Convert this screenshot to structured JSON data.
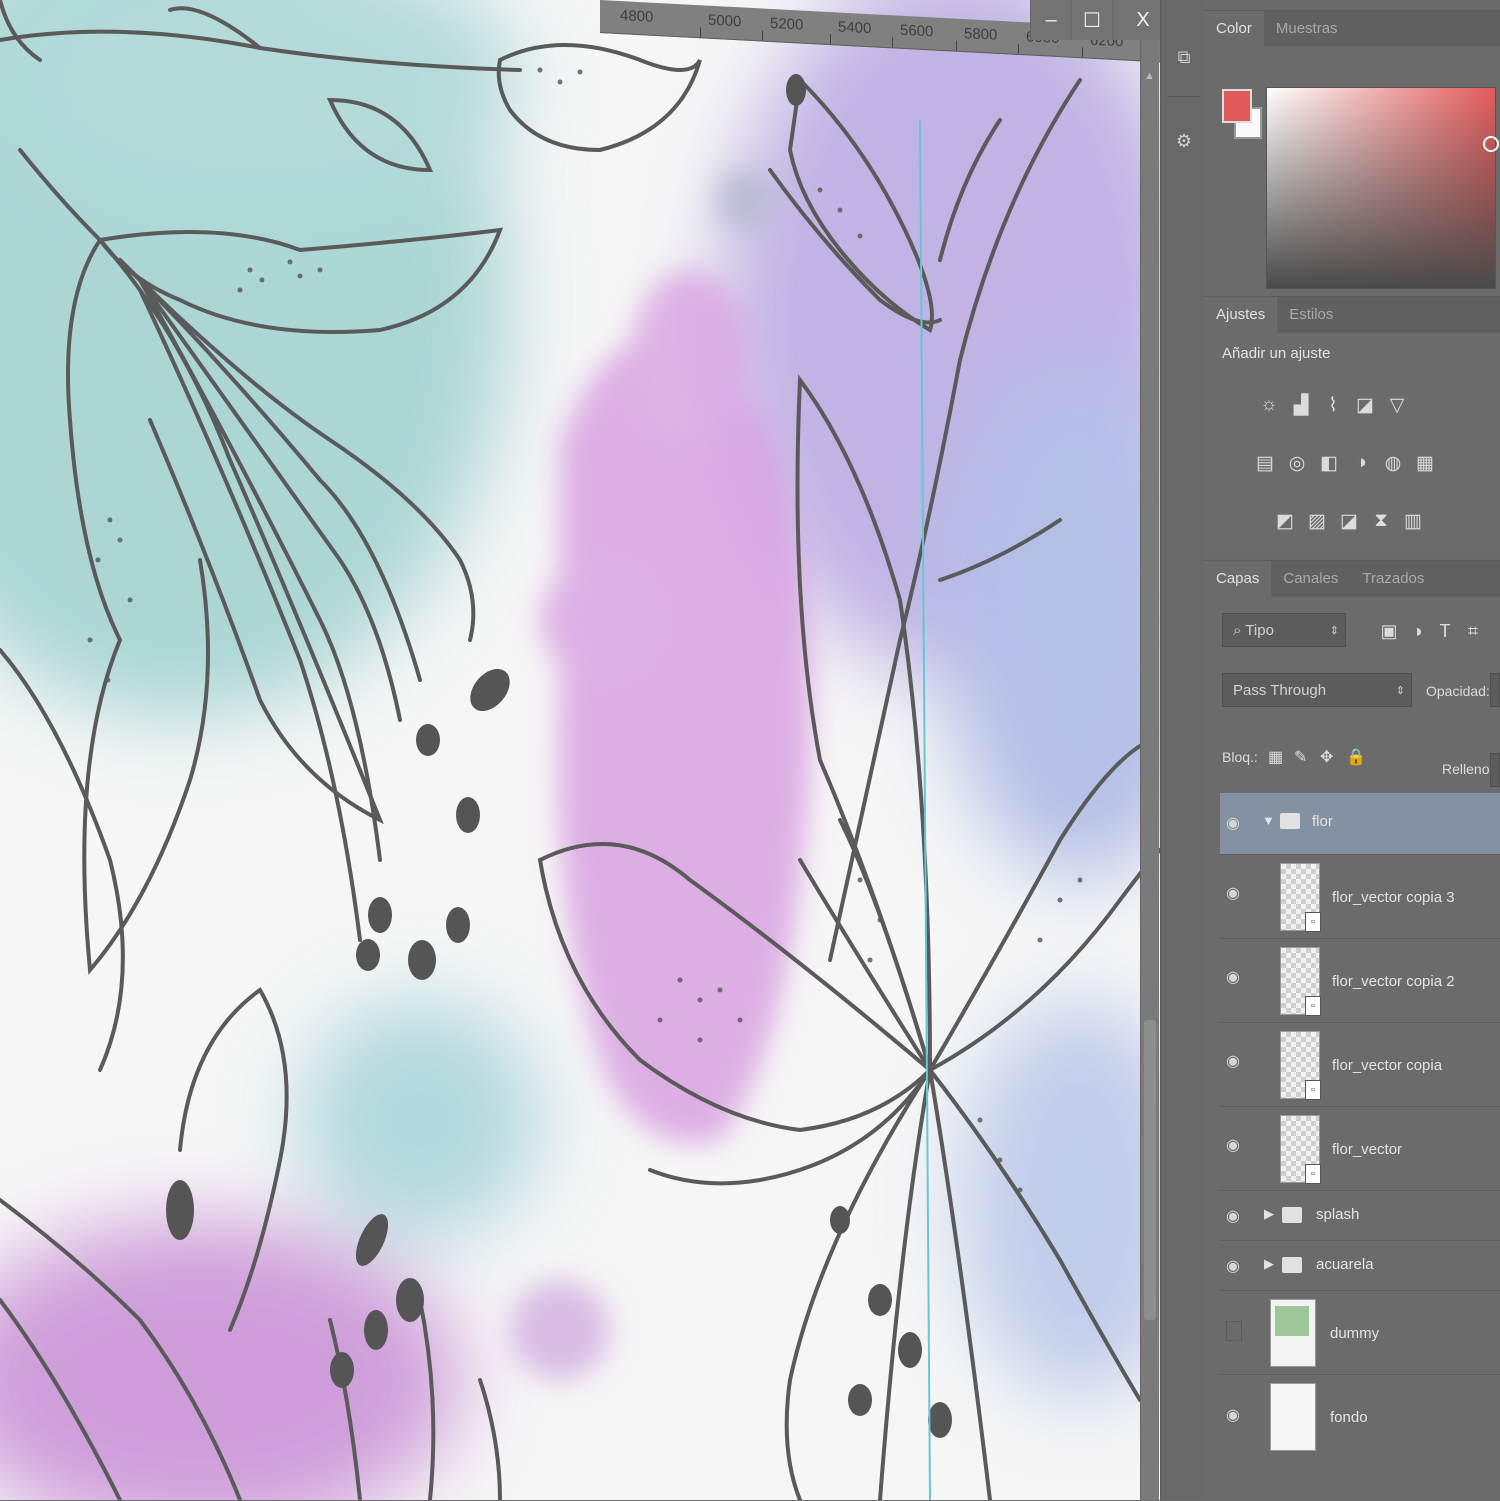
{
  "ruler": {
    "ticks": [
      "4800",
      "5000",
      "5200",
      "5400",
      "5600",
      "5800",
      "6000",
      "6200"
    ]
  },
  "window": {
    "minimize": "–",
    "maximize": "☐",
    "close": "X"
  },
  "color_panel": {
    "tabs": [
      "Color",
      "Muestras"
    ],
    "foreground": "#e05a5a",
    "background": "#fafafa"
  },
  "adjustments_panel": {
    "tabs": [
      "Ajustes",
      "Estilos"
    ],
    "title": "Añadir un ajuste",
    "rows": [
      [
        "brightness-icon",
        "levels-icon",
        "curves-icon",
        "exposure-icon",
        "gradient-triangle-icon"
      ],
      [
        "vibrance-icon",
        "hue-saturation-icon",
        "color-balance-icon",
        "black-white-icon",
        "photo-filter-icon",
        "channel-mixer-icon",
        "color-lookup-icon"
      ],
      [
        "invert-icon",
        "posterize-icon",
        "threshold-icon",
        "selective-color-icon",
        "gradient-map-icon"
      ]
    ],
    "row_glyphs": [
      [
        "☼",
        "▟",
        "⌇",
        "◪",
        "▽"
      ],
      [
        "▤",
        "◎",
        "◧",
        "◑",
        "◍",
        "▦"
      ],
      [
        "◩",
        "▨",
        "◪",
        "⧗",
        "▥"
      ]
    ]
  },
  "layers_panel": {
    "tabs": [
      "Capas",
      "Canales",
      "Trazados"
    ],
    "filter_kind": "Tipo",
    "filter_icons": [
      "▣",
      "◑",
      "T",
      "⌗"
    ],
    "blend_mode": "Pass Through",
    "opacity_label": "Opacidad:",
    "lock_label": "Bloq.:",
    "lock_icons": [
      "▦",
      "✎",
      "✥",
      "🔒"
    ],
    "fill_label": "Relleno:",
    "layers": [
      {
        "name": "flor",
        "type": "group",
        "expanded": true,
        "selected": true,
        "visible": true
      },
      {
        "name": "flor_vector copia 3",
        "type": "smart-object",
        "visible": true
      },
      {
        "name": "flor_vector copia 2",
        "type": "smart-object",
        "visible": true
      },
      {
        "name": "flor_vector copia",
        "type": "smart-object",
        "visible": true
      },
      {
        "name": "flor_vector",
        "type": "smart-object",
        "visible": true
      },
      {
        "name": "splash",
        "type": "group",
        "expanded": false,
        "visible": true
      },
      {
        "name": "acuarela",
        "type": "group",
        "expanded": false,
        "visible": true
      },
      {
        "name": "dummy",
        "type": "layer",
        "thumb_color": "#9dc79a",
        "visible": false
      },
      {
        "name": "fondo",
        "type": "layer",
        "thumb_color": "#f7f7f7",
        "visible": true
      }
    ]
  },
  "colors": {
    "teal_wash": "#9fd1cf",
    "violet_wash": "#cf9ee0",
    "ink": "#5a5a5a",
    "guide": "#66c6d6"
  }
}
